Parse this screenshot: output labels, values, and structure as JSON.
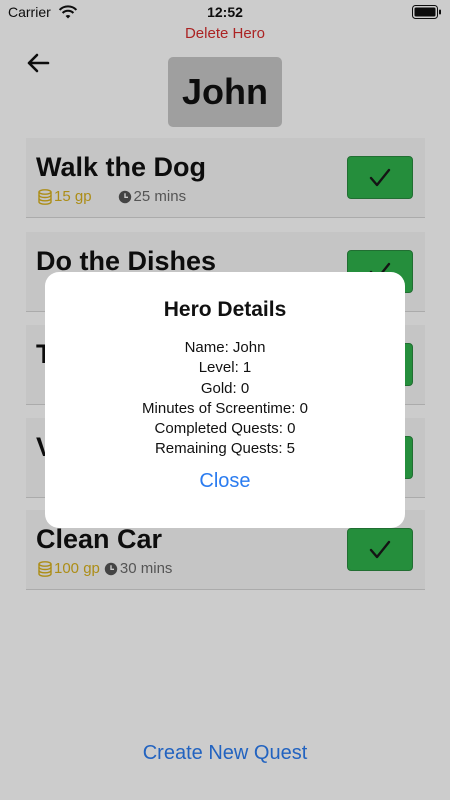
{
  "status_bar": {
    "carrier": "Carrier",
    "time": "12:52"
  },
  "header": {
    "delete_label": "Delete Hero",
    "hero_name": "John"
  },
  "quests": [
    {
      "title": "Walk the Dog",
      "gold": "15 gp",
      "time": "25 mins"
    },
    {
      "title": "Do the Dishes"
    },
    {
      "title": "T"
    },
    {
      "title": "V"
    },
    {
      "title": "Clean Car",
      "gold": "100 gp",
      "time": "30 mins"
    }
  ],
  "footer": {
    "create_label": "Create New Quest"
  },
  "modal": {
    "title": "Hero Details",
    "lines": [
      "Name: John",
      "Level: 1",
      "Gold: 0",
      "Minutes of Screentime: 0",
      "Completed Quests: 0",
      "Remaining Quests: 5"
    ],
    "close_label": "Close"
  },
  "colors": {
    "accent_blue": "#2b7cf0",
    "delete_red": "#d62c2c",
    "complete_green": "#2fb24b",
    "gold": "#d8b11d"
  },
  "icons": {
    "status": [
      "wifi-icon",
      "battery-icon"
    ],
    "nav": "back-arrow-icon",
    "quest_meta": [
      "coins-icon",
      "clock-icon"
    ],
    "complete": "checkmark-icon"
  }
}
